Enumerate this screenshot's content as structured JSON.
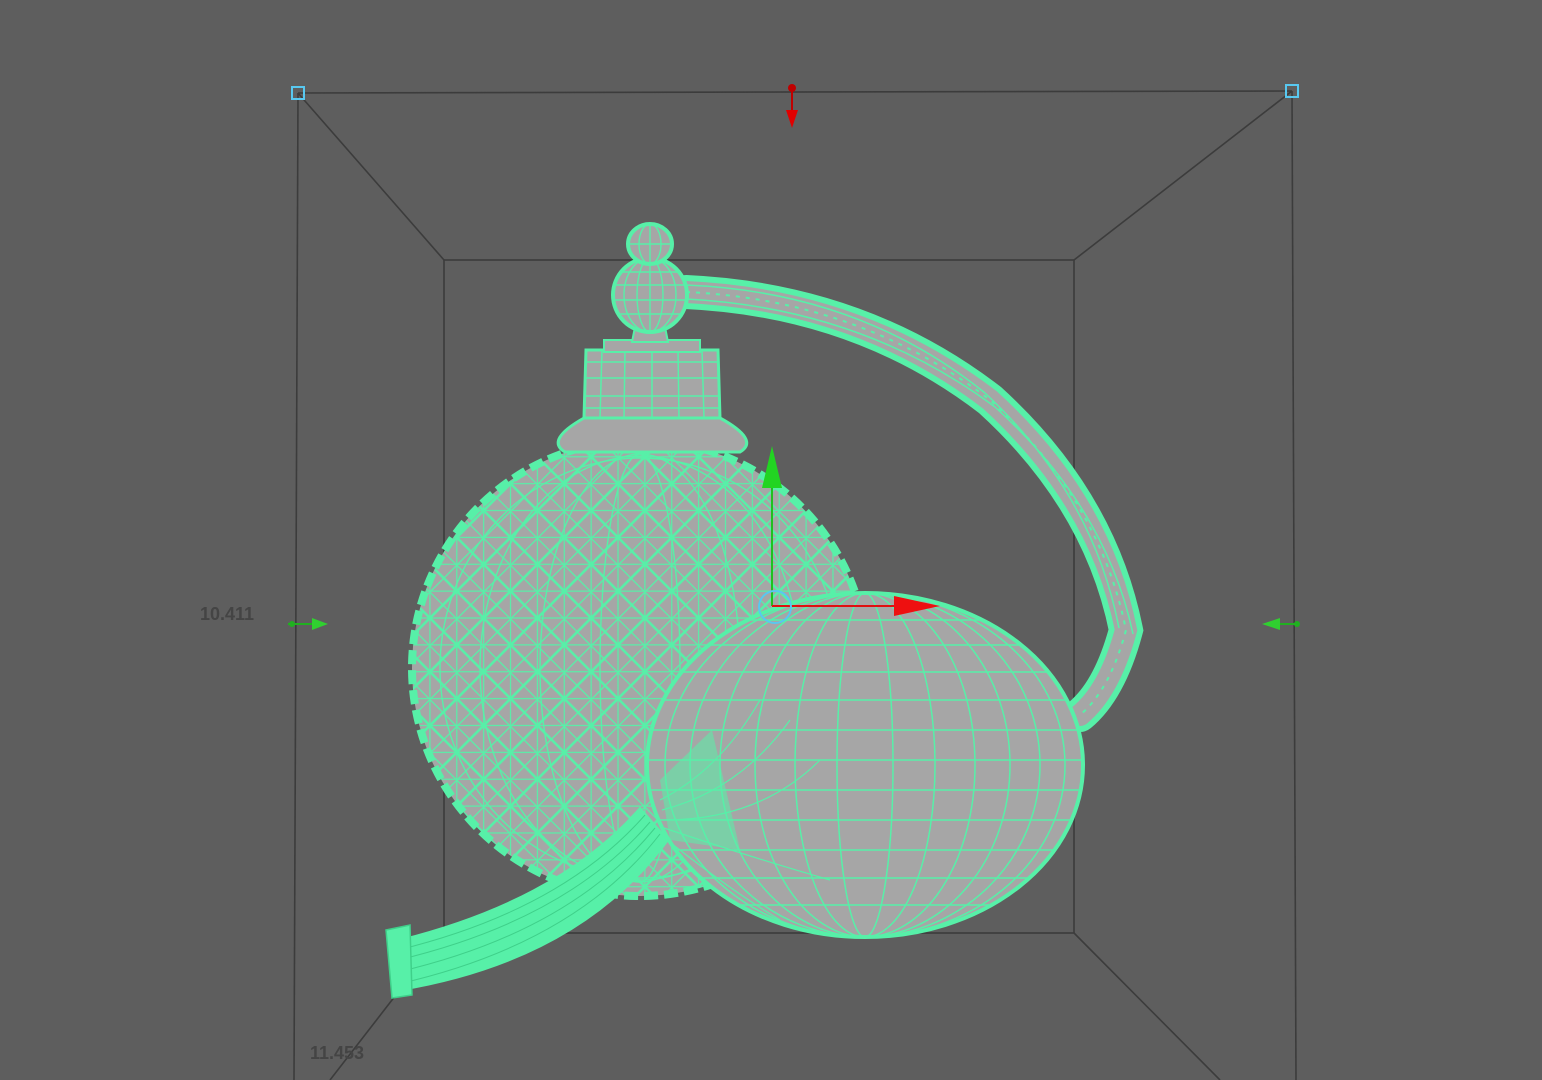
{
  "viewport": {
    "background": "#5e5e5e",
    "wireframe_color": "#57f0a8",
    "mesh_fill_color": "#a6a6a6",
    "bounding_box_color": "#3c3c3c",
    "handle_color": "#58c8f0",
    "icons": [
      "scale-box-corner-handle",
      "axis-x-arrow",
      "axis-y-arrow",
      "axis-z-marker",
      "manipulator-arrow"
    ]
  },
  "dimensions": {
    "height_label": "10.411",
    "depth_label": "11.453"
  }
}
